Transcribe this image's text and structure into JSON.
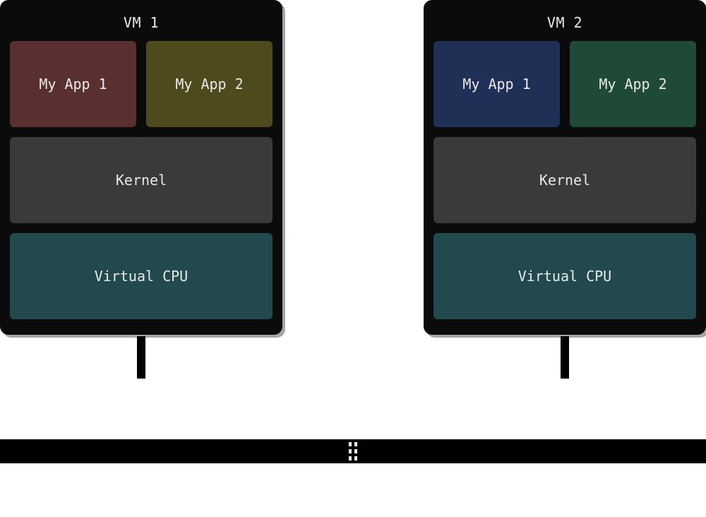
{
  "colors": {
    "vcpu": "#224a4e",
    "kernel": "#3a3a3a",
    "vm1_app1": "#5a2f2f",
    "vm1_app2": "#4e4a1d",
    "vm2_app1": "#1f2f55",
    "vm2_app2": "#1f4a35"
  },
  "vm1": {
    "title": "VM 1",
    "app1": "My App 1",
    "app2": "My App 2",
    "kernel": "Kernel",
    "vcpu": "Virtual CPU"
  },
  "vm2": {
    "title": "VM 2",
    "app1": "My App 1",
    "app2": "My App 2",
    "kernel": "Kernel",
    "vcpu": "Virtual CPU"
  }
}
